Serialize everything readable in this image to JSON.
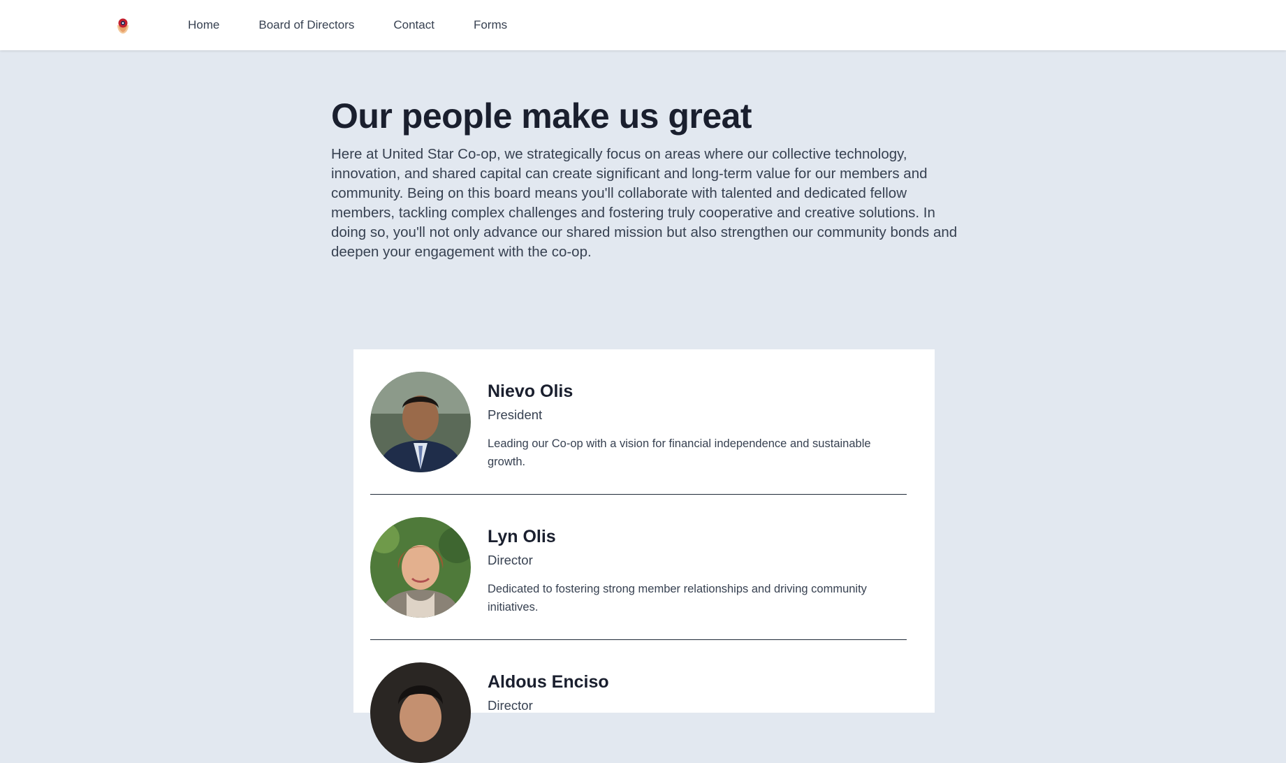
{
  "nav": {
    "logo_icon": "coop-logo-icon",
    "links": [
      "Home",
      "Board of Directors",
      "Contact",
      "Forms"
    ]
  },
  "hero": {
    "title": "Our people make us great",
    "description": "Here at United Star Co-op, we strategically focus on areas where our collective technology, innovation, and shared capital can create significant and long-term value for our members and community. Being on this board means you'll collaborate with talented and dedicated fellow members, tackling complex challenges and fostering truly cooperative and creative solutions. In doing so, you'll not only advance our shared mission but also strengthen our community bonds and deepen your engagement with the co-op."
  },
  "members": [
    {
      "name": "Nievo Olis",
      "role": "President",
      "bio": "Leading our Co-op with a vision for financial independence and sustainable growth."
    },
    {
      "name": "Lyn Olis",
      "role": "Director",
      "bio": "Dedicated to fostering strong member relationships and driving community initiatives."
    },
    {
      "name": "Aldous Enciso",
      "role": "Director",
      "bio": ""
    }
  ],
  "colors": {
    "page_bg": "#e2e8f0",
    "heading": "#1a1f2e",
    "body_text": "#374151"
  }
}
